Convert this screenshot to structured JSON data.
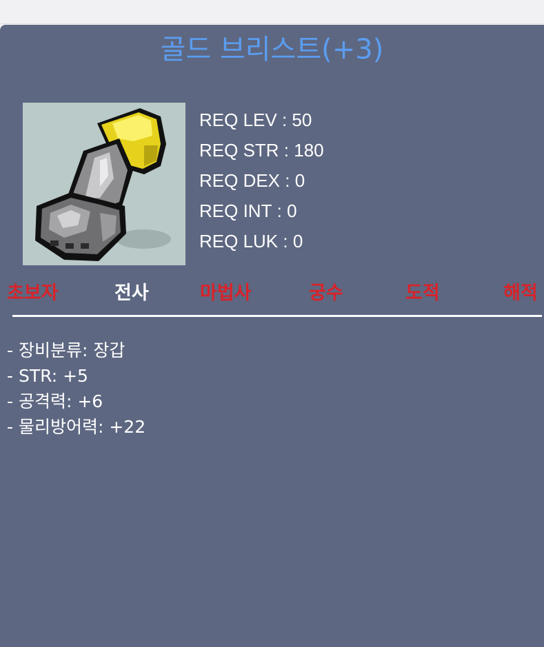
{
  "item": {
    "name": "골드 브리스트(+3)",
    "title_color": "#5b9df1",
    "icon": "gold-plated-gauntlet-icon"
  },
  "requirements": [
    {
      "label": "REQ LEV",
      "value": "50"
    },
    {
      "label": "REQ STR",
      "value": "180"
    },
    {
      "label": "REQ DEX",
      "value": "0"
    },
    {
      "label": "REQ INT",
      "value": "0"
    },
    {
      "label": "REQ LUK",
      "value": "0"
    }
  ],
  "jobs": [
    {
      "name": "초보자",
      "allowed": false,
      "color": "#d8232a"
    },
    {
      "name": "전사",
      "allowed": true,
      "color": "#ffffff"
    },
    {
      "name": "마법사",
      "allowed": false,
      "color": "#d8232a"
    },
    {
      "name": "궁수",
      "allowed": false,
      "color": "#d8232a"
    },
    {
      "name": "도적",
      "allowed": false,
      "color": "#d8232a"
    },
    {
      "name": "해적",
      "allowed": false,
      "color": "#d8232a"
    }
  ],
  "stats": [
    "- 장비분류: 장갑",
    "- STR: +5",
    "- 공격력: +6",
    "- 물리방어력: +22"
  ],
  "colors": {
    "panel_background": "#5d6781",
    "image_background": "#b9cac9",
    "text": "#ffffff",
    "disallowed_job": "#d8232a"
  }
}
